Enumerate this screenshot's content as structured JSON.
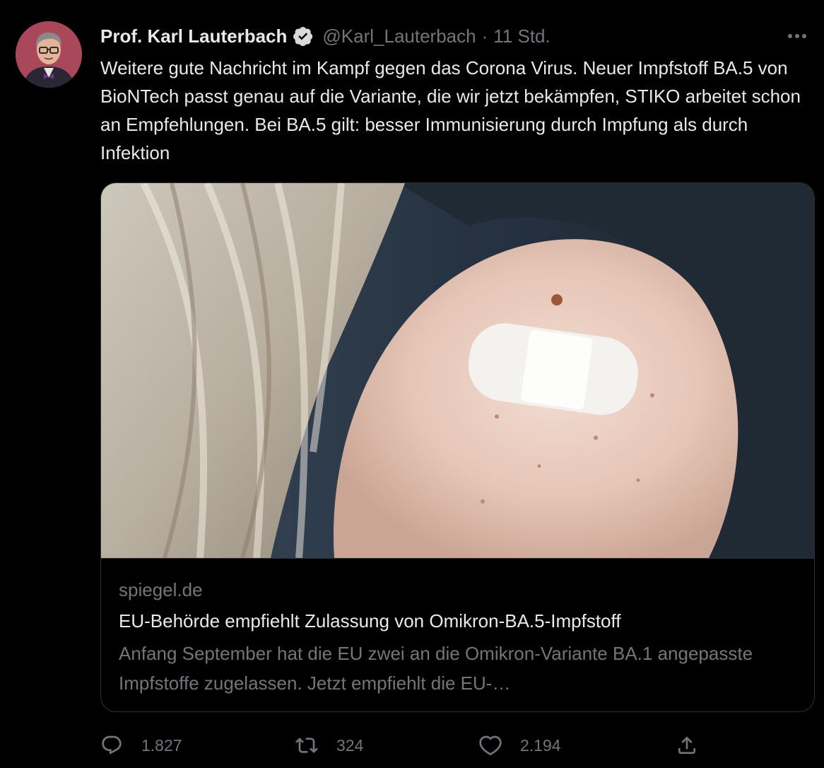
{
  "tweet": {
    "author_name": "Prof. Karl Lauterbach",
    "handle": "@Karl_Lauterbach",
    "separator": "·",
    "time": "11 Std.",
    "text": "Weitere gute Nachricht im Kampf gegen das Corona Virus. Neuer Impfstoff BA.5 von BioNTech passt genau auf die Variante, die wir jetzt bekämpfen, STIKO arbeitet schon an Empfehlungen. Bei BA.5 gilt: besser Immunisierung durch Impfung als durch Infektion"
  },
  "card": {
    "domain": "spiegel.de",
    "title": "EU-Behörde empfiehlt Zulassung von Omikron-BA.5-Impfstoff",
    "description": "Anfang September hat die EU zwei an die Omikron-Variante BA.1 angepasste Impfstoffe zugelassen. Jetzt empfiehlt die EU-…"
  },
  "actions": {
    "replies": "1.827",
    "retweets": "324",
    "likes": "2.194"
  },
  "icons": {
    "verified": "verified-badge-icon",
    "more": "more-horizontal-icon",
    "reply": "reply-bubble-icon",
    "retweet": "retweet-arrows-icon",
    "like": "heart-icon",
    "share": "share-upload-icon"
  },
  "colors": {
    "background": "#000000",
    "text_primary": "#e7e9ea",
    "text_secondary": "#71767b",
    "border": "#2f3336"
  }
}
